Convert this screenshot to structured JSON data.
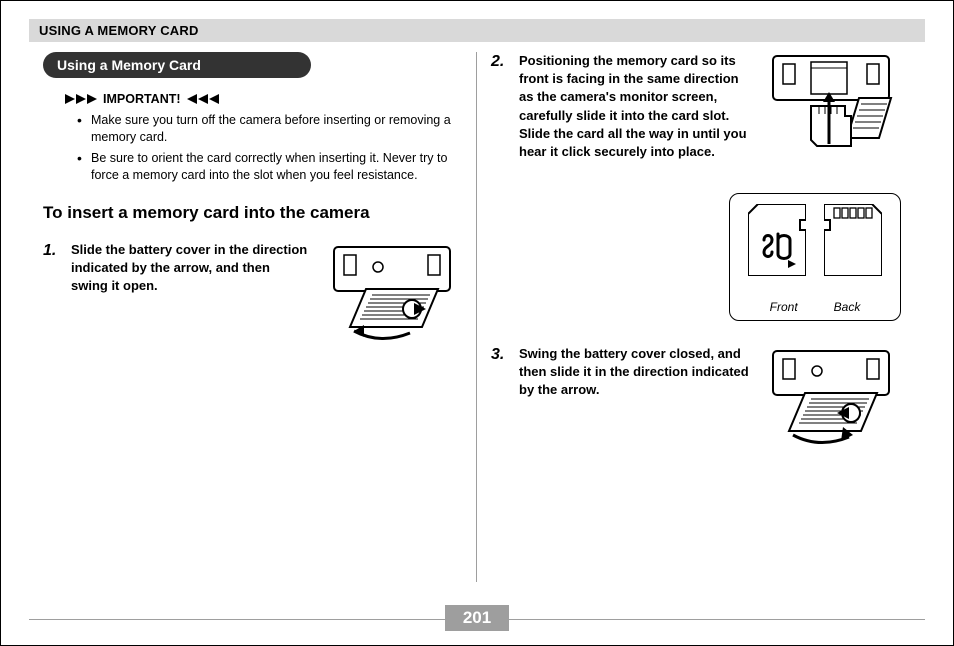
{
  "header": {
    "title": "USING A MEMORY CARD"
  },
  "section": {
    "pill": "Using a Memory Card"
  },
  "important": {
    "label": "IMPORTANT!",
    "bullets": [
      "Make sure you turn off the camera before inserting or removing a memory card.",
      "Be sure to orient the card correctly when inserting it. Never try to force a memory card into the slot when you feel resistance."
    ]
  },
  "subheading": "To insert a memory card into the camera",
  "steps": {
    "s1": {
      "num": "1.",
      "text": "Slide the battery cover in the direction indicated by the arrow, and then swing it open."
    },
    "s2": {
      "num": "2.",
      "text": "Positioning the memory card so its front is facing in the same direction as the camera's monitor screen, carefully slide it into the card slot. Slide the card all the way in until you hear it click securely into place."
    },
    "s3": {
      "num": "3.",
      "text": "Swing the battery cover closed, and then slide it in the direction indicated by the arrow."
    }
  },
  "sd": {
    "front": "Front",
    "back": "Back"
  },
  "page_number": "201",
  "icons": {
    "arrow_right_black": "arrow-right-black-icon",
    "arrow_left_black": "arrow-left-black-icon",
    "camera_open": "camera-battery-open-icon",
    "camera_insert": "camera-insert-card-icon",
    "camera_close": "camera-battery-close-icon",
    "sd_front": "sd-card-front-icon",
    "sd_back": "sd-card-back-icon"
  }
}
